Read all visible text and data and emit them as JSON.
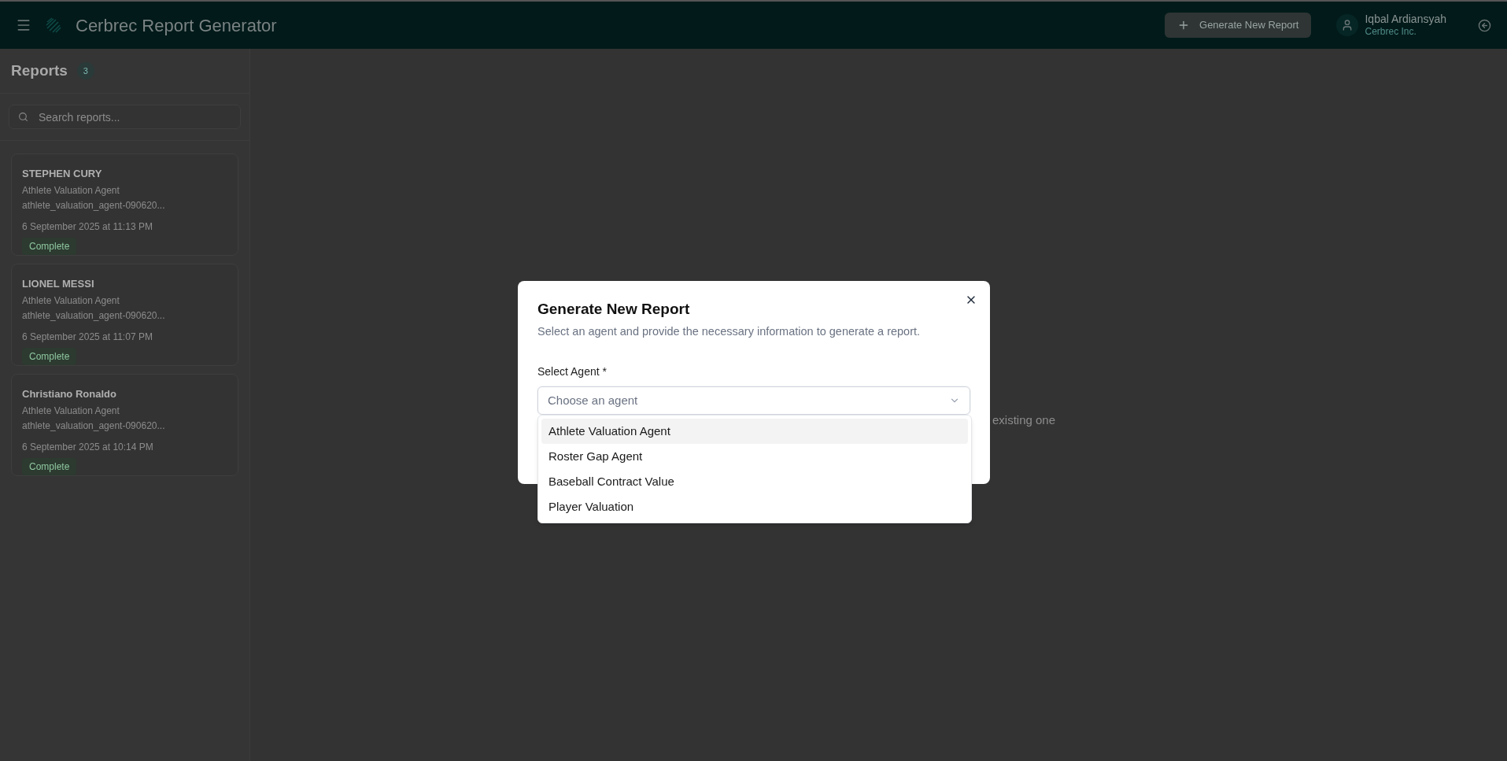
{
  "header": {
    "title": "Cerbrec Report Generator",
    "new_report_button": "Generate New Report",
    "user": {
      "name": "Iqbal Ardiansyah",
      "organization": "Cerbrec Inc."
    }
  },
  "sidebar": {
    "title": "Reports",
    "count": "3",
    "search": {
      "placeholder": "Search reports..."
    },
    "reports": [
      {
        "name": "STEPHEN CURY",
        "agent": "Athlete Valuation Agent",
        "id": "athlete_valuation_agent-090620...",
        "date": "6 September 2025 at 11:13 PM",
        "status": "Complete"
      },
      {
        "name": "LIONEL MESSI",
        "agent": "Athlete Valuation Agent",
        "id": "athlete_valuation_agent-090620...",
        "date": "6 September 2025 at 11:07 PM",
        "status": "Complete"
      },
      {
        "name": "Christiano Ronaldo",
        "agent": "Athlete Valuation Agent",
        "id": "athlete_valuation_agent-090620...",
        "date": "6 September 2025 at 10:14 PM",
        "status": "Complete"
      }
    ]
  },
  "main": {
    "empty_text": "existing one"
  },
  "dialog": {
    "title": "Generate New Report",
    "description": "Select an agent and provide the necessary information to generate a report.",
    "field_label": "Select Agent *",
    "select": {
      "placeholder": "Choose an agent",
      "expanded": true
    },
    "options": [
      {
        "label": "Athlete Valuation Agent",
        "selected": true
      },
      {
        "label": "Roster Gap Agent",
        "selected": false
      },
      {
        "label": "Baseball Contract Value",
        "selected": false
      },
      {
        "label": "Player Valuation",
        "selected": false
      }
    ]
  }
}
